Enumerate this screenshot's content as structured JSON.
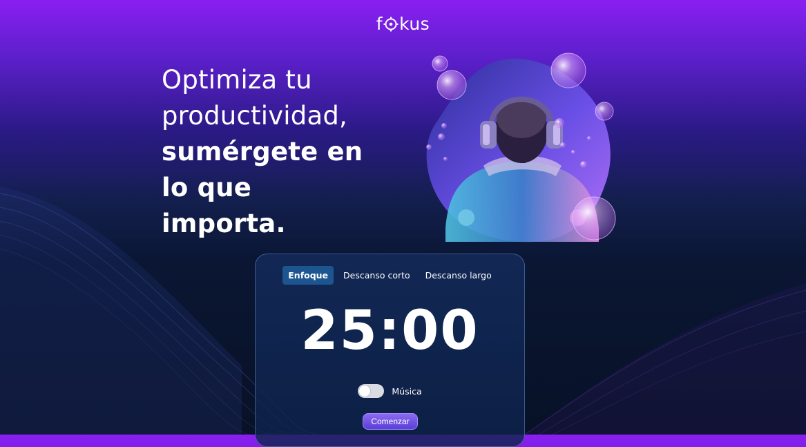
{
  "brand": {
    "logo_before": "f",
    "logo_after": "kus"
  },
  "hero": {
    "light_line_1": "Optimiza tu",
    "light_line_2": "productividad,",
    "bold_line_1": "sumérgete en",
    "bold_line_2": "lo que",
    "bold_line_3": "importa."
  },
  "timer": {
    "tabs": [
      {
        "label": "Enfoque",
        "active": true
      },
      {
        "label": "Descanso corto",
        "active": false
      },
      {
        "label": "Descanso largo",
        "active": false
      }
    ],
    "time": "25:00",
    "music_label": "Música",
    "music_on": false,
    "start_label": "Comenzar"
  },
  "colors": {
    "accent_purple": "#8a1ff2",
    "tab_active": "#1d5590",
    "button": "#6a4fe0"
  },
  "icons": [
    "focus-target-icon",
    "hero-illustration"
  ]
}
